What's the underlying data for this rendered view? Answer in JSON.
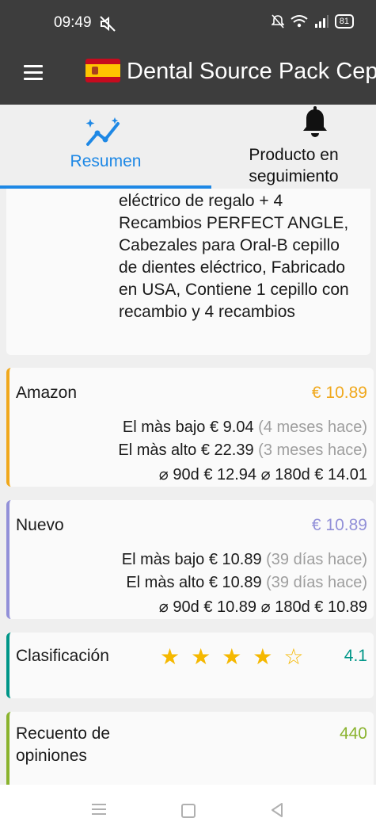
{
  "status": {
    "time": "09:49",
    "battery": "81"
  },
  "app": {
    "title": "Dental Source Pack Cepillo"
  },
  "tabs": [
    {
      "label": "Resumen",
      "icon": "auto-graph-icon",
      "active": true
    },
    {
      "label": "Producto en seguimiento",
      "icon": "bell-icon",
      "active": false
    }
  ],
  "description": "eléctrico de regalo + 4 Recambios PERFECT ANGLE, Cabezales para Oral-B cepillo de dientes eléctrico, Fabricado en USA, Contiene 1 cepillo con recambio y 4 recambios",
  "amazon": {
    "label": "Amazon",
    "price": "€ 10.89",
    "color": "#f0a81c",
    "low_label": "El màs bajo",
    "low_value": "€ 9.04",
    "low_ago": "(4 meses hace)",
    "high_label": "El màs alto",
    "high_value": "€ 22.39",
    "high_ago": "(3 meses hace)",
    "avg90_label": "⌀ 90d",
    "avg90_value": "€ 12.94",
    "avg180_label": "⌀ 180d",
    "avg180_value": "€ 14.01"
  },
  "nuevo": {
    "label": "Nuevo",
    "price": "€ 10.89",
    "color": "#9290d8",
    "low_label": "El màs bajo",
    "low_value": "€ 10.89",
    "low_ago": "(39 días hace)",
    "high_label": "El màs alto",
    "high_value": "€ 10.89",
    "high_ago": "(39 días hace)",
    "avg90_label": "⌀ 90d",
    "avg90_value": "€ 10.89",
    "avg180_label": "⌀ 180d",
    "avg180_value": "€ 10.89"
  },
  "rating": {
    "label": "Clasificación",
    "stars_display": "★★★★☆",
    "value": "4.1",
    "color": "#009688"
  },
  "reviews": {
    "label": "Recuento de opiniones",
    "value": "440",
    "color": "#8ab32e"
  }
}
